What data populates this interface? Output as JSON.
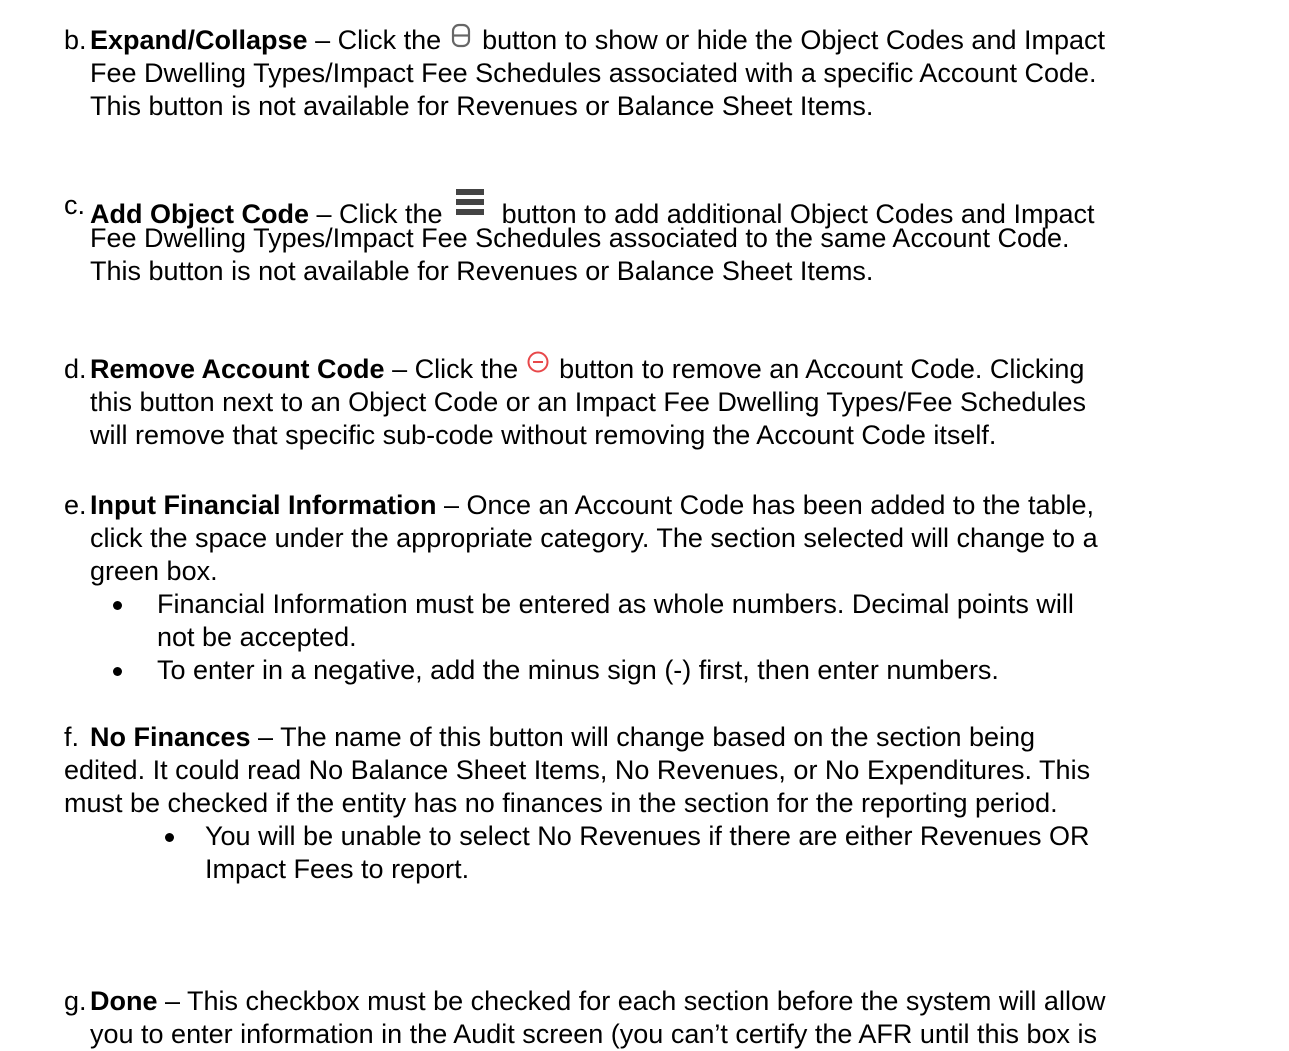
{
  "items": [
    {
      "marker": "b.",
      "title": "Expand/Collapse",
      "before_icon": " – Click the ",
      "icon": "expand-collapse-icon",
      "after_icon": " button to show or hide the Object Codes and Impact",
      "lines": [
        "Fee Dwelling Types/Impact Fee Schedules associated with a specific Account Code.",
        "This button is not available for Revenues or Balance Sheet Items."
      ]
    },
    {
      "marker": "c.",
      "title": "Add Object Code",
      "before_icon": " – Click the ",
      "icon": "add-object-code-icon",
      "after_icon": " button to add additional Object Codes and Impact",
      "lines": [
        "Fee Dwelling Types/Impact Fee Schedules associated to the same Account Code.",
        "This button is not available for Revenues or Balance Sheet Items."
      ]
    },
    {
      "marker": "d.",
      "title": "Remove Account Code",
      "before_icon": " – Click the ",
      "icon": "remove-account-code-icon",
      "after_icon": " button to remove an Account Code. Clicking",
      "lines": [
        "this button next to an Object Code or an Impact Fee Dwelling Types/Fee Schedules",
        "will remove that specific sub-code without removing the Account Code itself."
      ]
    },
    {
      "marker": "e.",
      "title": "Input Financial Information",
      "rest": " – Once an Account Code has been added to the table,",
      "lines": [
        "click the space under the appropriate category. The section selected will change to a",
        "green box."
      ],
      "bullets": [
        [
          "Financial Information must be entered as whole numbers. Decimal points will",
          "not be accepted."
        ],
        [
          "To enter in a negative, add the minus sign (-) first, then enter numbers."
        ]
      ]
    },
    {
      "marker": "f.",
      "title": "No Finances",
      "rest": " – The name of this button will change based on the section being",
      "lines": [
        "edited. It could read No Balance Sheet Items, No Revenues, or No Expenditures. This",
        "must be checked if the entity has no finances in the section for the reporting period."
      ],
      "bullets": [
        [
          "You will be unable to select No Revenues if there are either Revenues OR",
          "Impact Fees to report."
        ]
      ]
    },
    {
      "marker": "g.",
      "title": "Done",
      "rest": " – This checkbox must be checked for each section before the system will allow",
      "lines": [
        "you to enter information in the Audit screen (you can’t certify the AFR until this box is"
      ]
    }
  ],
  "colors": {
    "text": "#000000",
    "icon_gray": "#666666",
    "icon_bars": "#444444",
    "remove_red": "#e8484a"
  }
}
